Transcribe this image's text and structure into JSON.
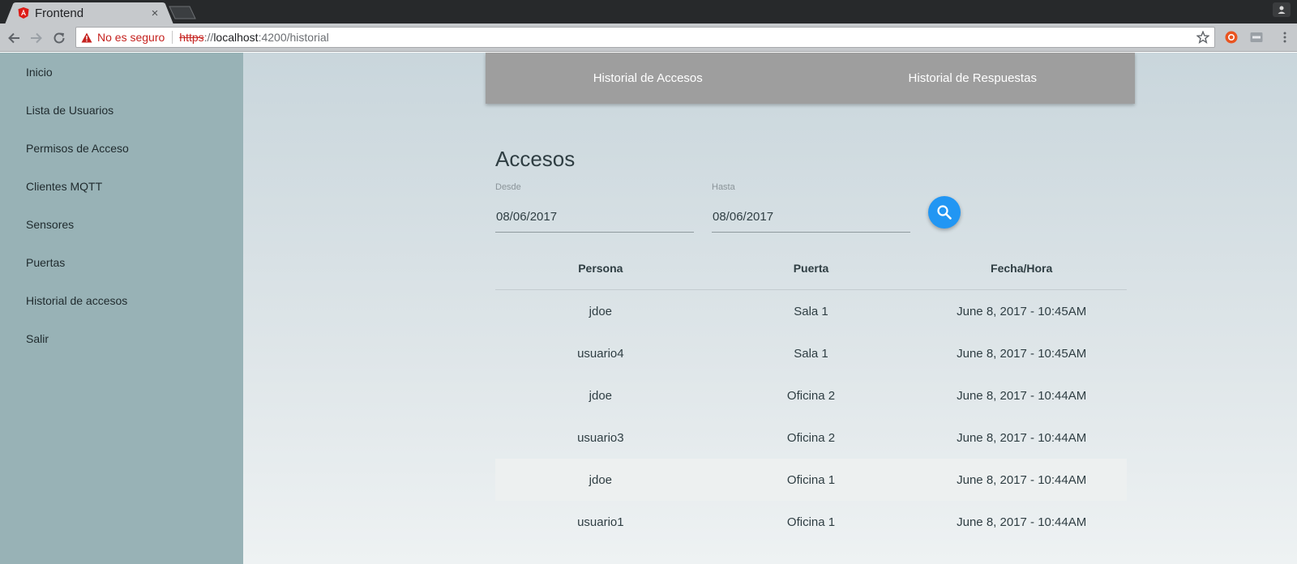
{
  "browser": {
    "tab_title": "Frontend",
    "tab_close": "×",
    "security_text": "No es seguro",
    "url_proto": "https",
    "url_sep": "://",
    "url_host": "localhost",
    "url_path": ":4200/historial"
  },
  "sidebar": {
    "items": [
      {
        "label": "Inicio"
      },
      {
        "label": "Lista de Usuarios"
      },
      {
        "label": "Permisos de Acceso"
      },
      {
        "label": "Clientes MQTT"
      },
      {
        "label": "Sensores"
      },
      {
        "label": "Puertas"
      },
      {
        "label": "Historial de accesos"
      },
      {
        "label": "Salir"
      }
    ]
  },
  "tabs": [
    {
      "label": "Historial de Accesos"
    },
    {
      "label": "Historial de Respuestas"
    }
  ],
  "main": {
    "heading": "Accesos",
    "from_label": "Desde",
    "from_value": "08/06/2017",
    "to_label": "Hasta",
    "to_value": "08/06/2017"
  },
  "table": {
    "headers": [
      "Persona",
      "Puerta",
      "Fecha/Hora"
    ],
    "rows": [
      [
        "jdoe",
        "Sala 1",
        "June 8, 2017 - 10:45AM"
      ],
      [
        "usuario4",
        "Sala 1",
        "June 8, 2017 - 10:45AM"
      ],
      [
        "jdoe",
        "Oficina 2",
        "June 8, 2017 - 10:44AM"
      ],
      [
        "usuario3",
        "Oficina 2",
        "June 8, 2017 - 10:44AM"
      ],
      [
        "jdoe",
        "Oficina 1",
        "June 8, 2017 - 10:44AM"
      ],
      [
        "usuario1",
        "Oficina 1",
        "June 8, 2017 - 10:44AM"
      ]
    ]
  },
  "colors": {
    "sidebar": "#98b2b6",
    "tabs_bg": "#9e9e9e",
    "accent": "#2196f3",
    "insecure": "#c5221f"
  },
  "icons": {
    "favicon": "angular-icon",
    "warning": "warning-icon",
    "search": "search-icon",
    "star": "star-icon"
  }
}
